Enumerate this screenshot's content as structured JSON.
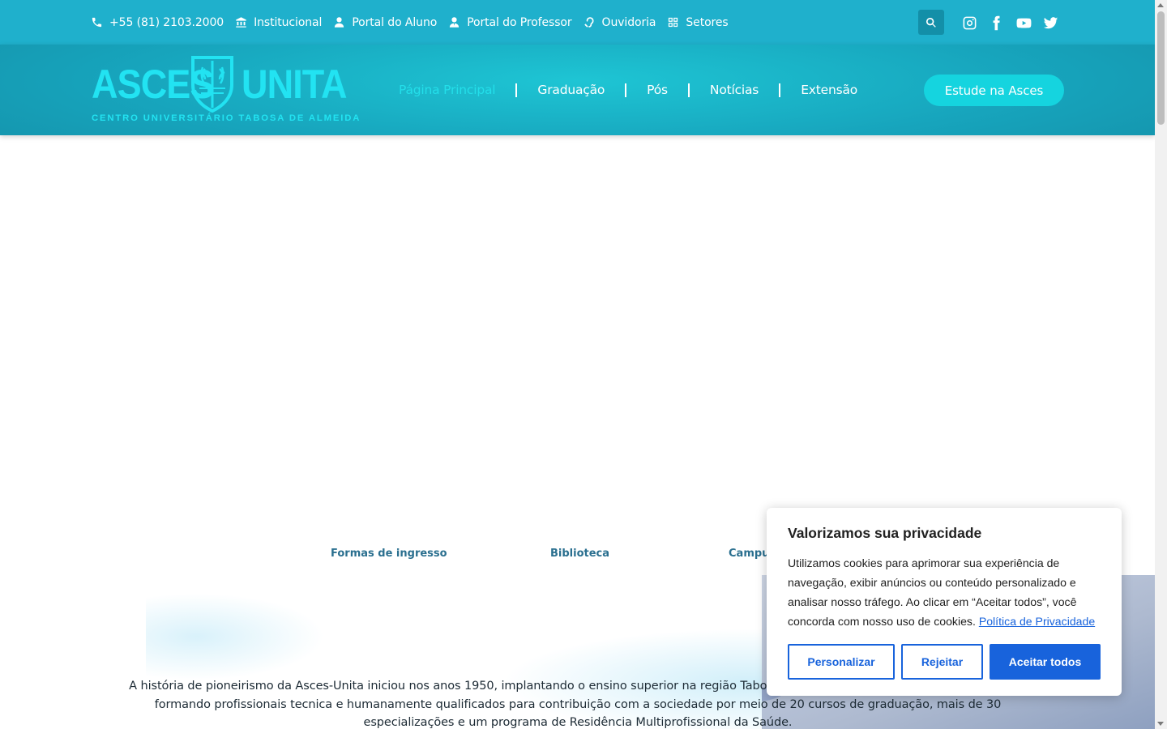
{
  "topbar": {
    "links": [
      {
        "label": "+55 (81) 2103.2000",
        "icon": "phone-icon"
      },
      {
        "label": "Institucional",
        "icon": "institution-icon"
      },
      {
        "label": "Portal do Aluno",
        "icon": "user-icon"
      },
      {
        "label": "Portal do Professor",
        "icon": "teacher-icon"
      },
      {
        "label": "Ouvidoria",
        "icon": "ear-icon"
      },
      {
        "label": "Setores",
        "icon": "grid-icon"
      }
    ],
    "search_icon": "search-icon",
    "social": [
      "instagram-icon",
      "facebook-icon",
      "youtube-icon",
      "twitter-icon"
    ]
  },
  "header": {
    "logo": {
      "word_left": "ASCES",
      "word_right": "UNITA",
      "subtitle": "CENTRO UNIVERSITÁRIO TABOSA DE ALMEIDA"
    },
    "nav": [
      "Página Principal",
      "Graduação",
      "Pós",
      "Notícias",
      "Extensão"
    ],
    "active_nav": "Página Principal",
    "cta": "Estude na Asces"
  },
  "quick_links": [
    "Formas de ingresso",
    "Biblioteca",
    "Campu"
  ],
  "history_text": "A história de pioneirismo da Asces-Unita iniciou nos anos 1950, implantando o ensino superior na região Tabosa de Almeida. Hoje, segue como referência, formando profissionais tecnica e humanamente qualificados para contribuição com a sociedade por meio de 20 cursos de graduação, mais de 30 especializações e um programa de Residência Multiprofissional da Saúde.",
  "cookie": {
    "title": "Valorizamos sua privacidade",
    "body": "Utilizamos cookies para aprimorar sua experiência de navegação, exibir anúncios ou conteúdo personalizado e analisar nosso tráfego. Ao clicar em “Aceitar todos”, você concorda com nosso uso de cookies.",
    "policy_link": "Política de Privacidade",
    "buttons": {
      "customize": "Personalizar",
      "reject": "Rejeitar",
      "accept": "Aceitar todos"
    }
  },
  "colors": {
    "topbar": "#1fb0cc",
    "header_accent": "#22e3f2",
    "cta": "#15d4df",
    "cookie_blue": "#1863dc"
  }
}
